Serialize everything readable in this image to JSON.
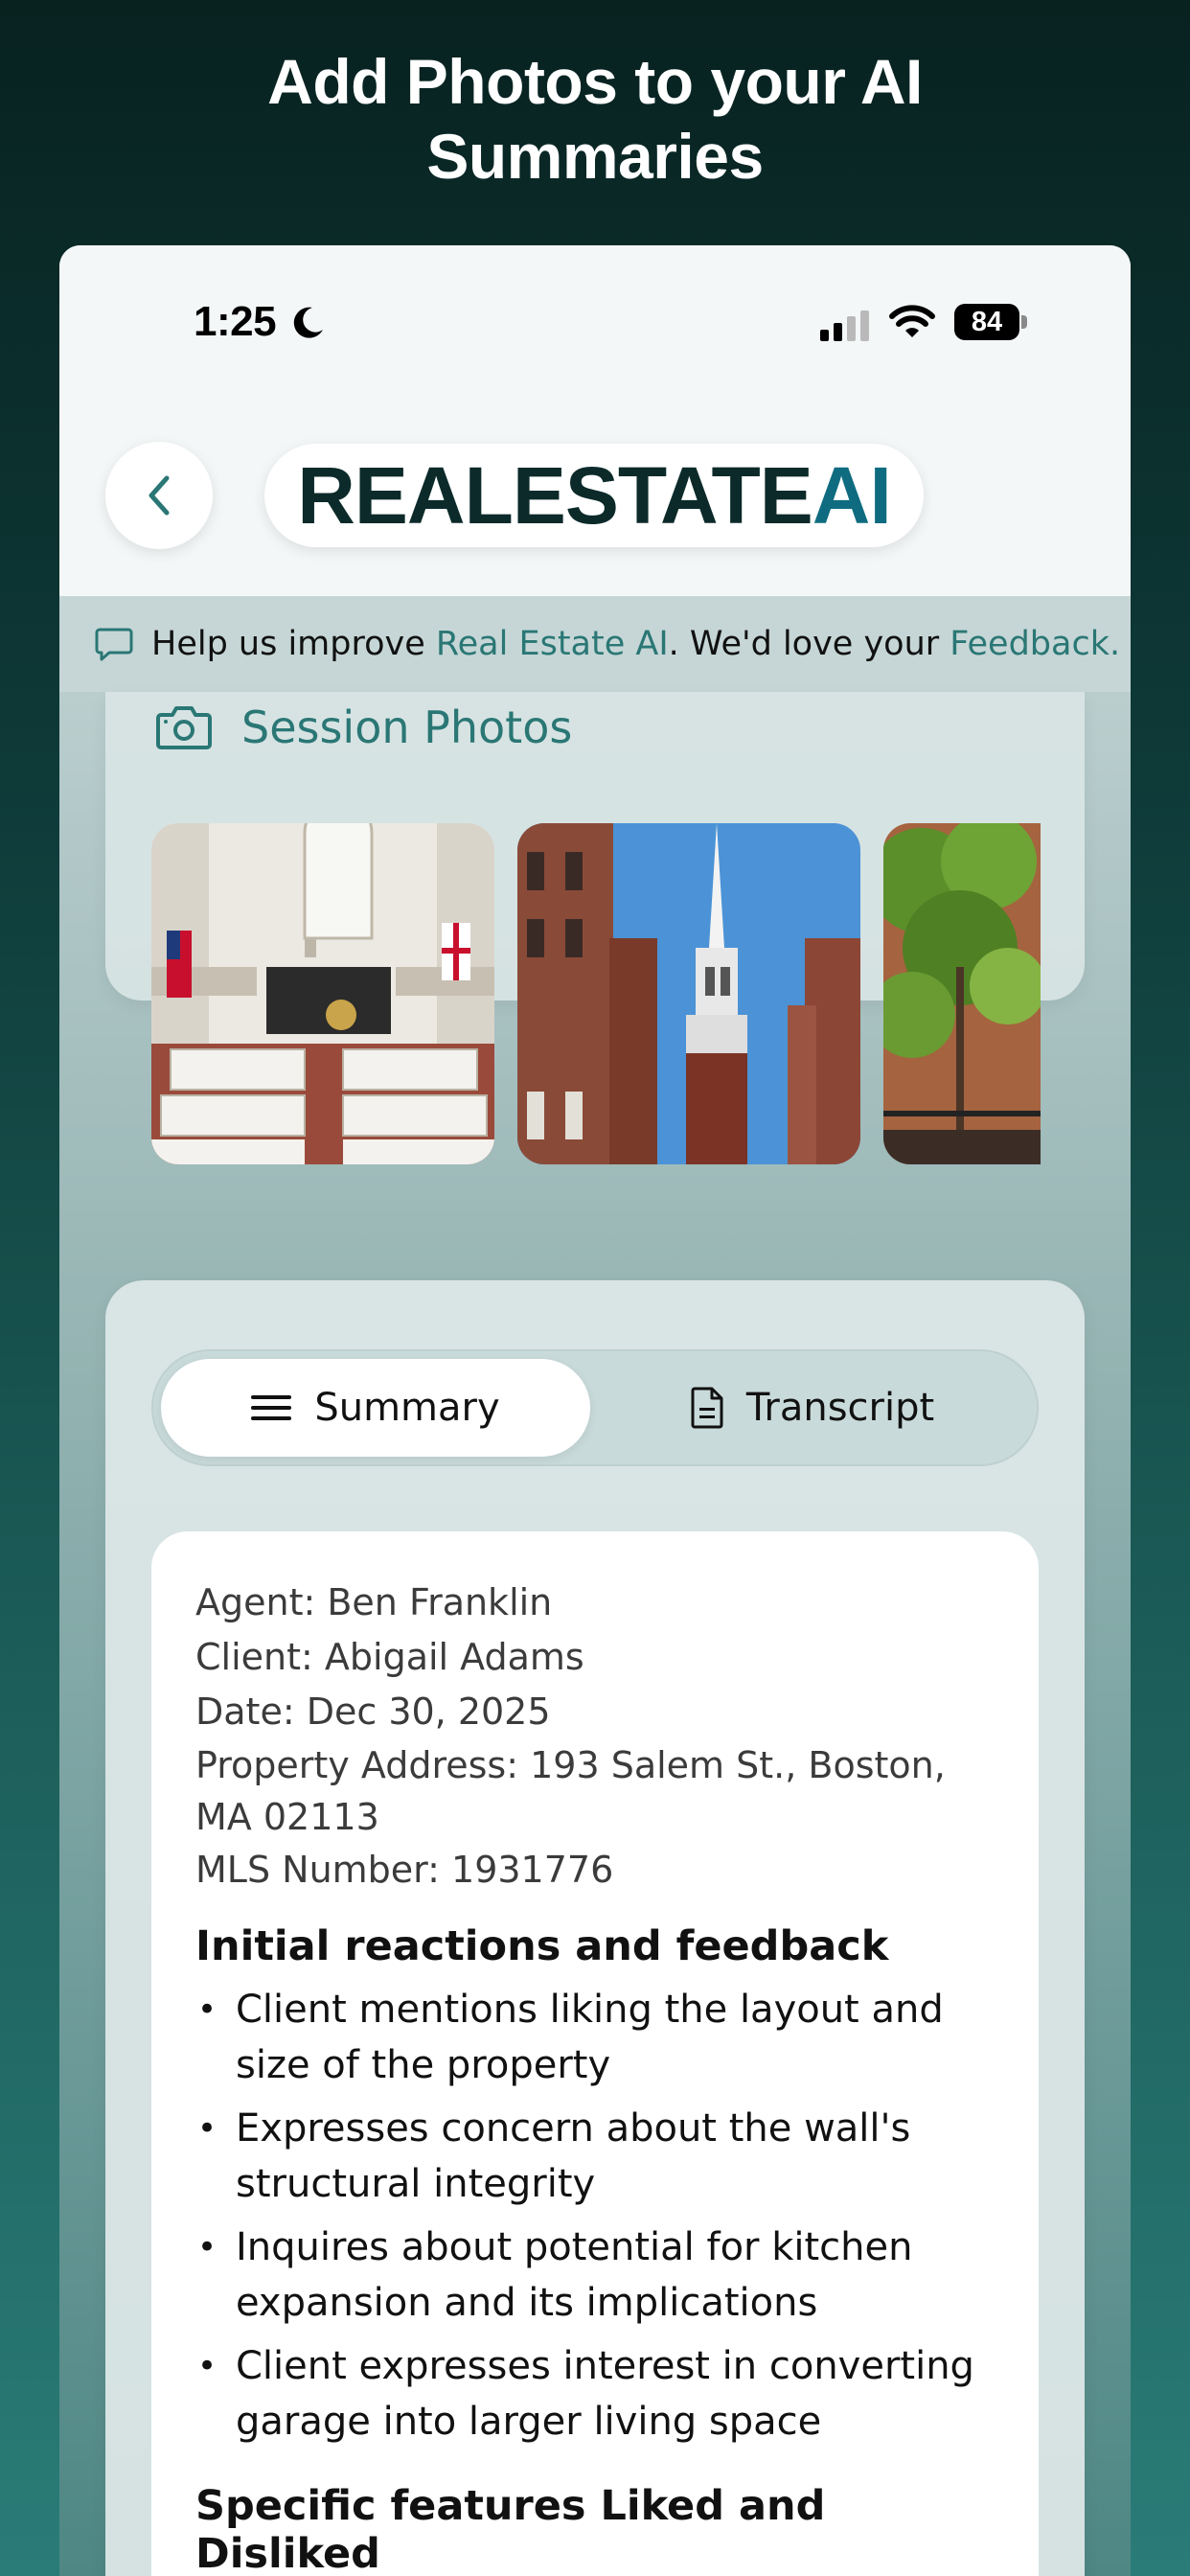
{
  "promo": {
    "title_line1": "Add Photos to your AI",
    "title_line2": "Summaries"
  },
  "status_bar": {
    "time": "1:25",
    "battery": "84"
  },
  "header": {
    "logo_part1": "REALESTATE",
    "logo_part2": "AI"
  },
  "feedback": {
    "prefix": "Help us improve ",
    "brand": "Real Estate AI",
    "middle": ". We'd love your ",
    "link": "Feedback."
  },
  "photos": {
    "title": "Session Photos"
  },
  "tabs": {
    "summary": "Summary",
    "transcript": "Transcript"
  },
  "summary": {
    "agent": "Agent: Ben Franklin",
    "client": "Client: Abigail Adams",
    "date": "Date: Dec 30, 2025",
    "address_line1": "Property Address: 193 Salem St., Boston,",
    "address_line2": "MA 02113",
    "mls": "MLS Number: 1931776",
    "section1_title": "Initial reactions and feedback",
    "section1_items": [
      "Client mentions liking the layout and size of the property",
      "Expresses concern about the wall's structural integrity",
      "Inquires about potential for kitchen expansion and its implications",
      "Client expresses interest in converting garage into larger living space"
    ],
    "section2_title": "Specific features Liked and Disliked"
  },
  "colors": {
    "accent_teal": "#2a7775",
    "logo_dark": "#0c2a2a",
    "logo_ai": "#0f6c80"
  }
}
